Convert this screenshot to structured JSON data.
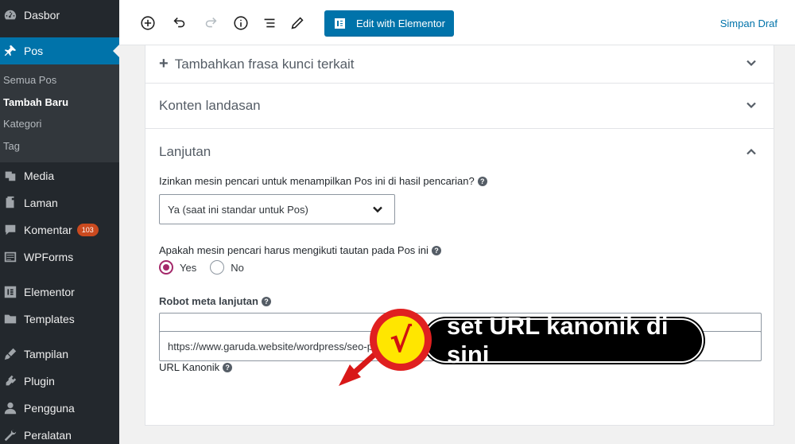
{
  "sidebar": {
    "items_top": [
      {
        "label": "Dasbor",
        "icon": "dashboard-icon"
      },
      {
        "label": "Pos",
        "icon": "pin-icon",
        "active": true
      }
    ],
    "submenu": [
      "Semua Pos",
      "Tambah Baru",
      "Kategori",
      "Tag"
    ],
    "items_bottom": [
      {
        "label": "Media",
        "icon": "media-icon"
      },
      {
        "label": "Laman",
        "icon": "pages-icon"
      },
      {
        "label": "Komentar",
        "icon": "comments-icon",
        "badge": "103"
      },
      {
        "label": "WPForms",
        "icon": "wpforms-icon"
      },
      {
        "label": "Elementor",
        "icon": "elementor-icon"
      },
      {
        "label": "Templates",
        "icon": "folder-icon"
      },
      {
        "label": "Tampilan",
        "icon": "appearance-icon"
      },
      {
        "label": "Plugin",
        "icon": "plugin-icon"
      },
      {
        "label": "Pengguna",
        "icon": "user-icon"
      },
      {
        "label": "Peralatan",
        "icon": "tools-icon"
      }
    ]
  },
  "toolbar": {
    "elementor_label": "Edit with Elementor",
    "save_draft": "Simpan Draf"
  },
  "panel": {
    "related_keyphrase": "Tambahkan frasa kunci terkait",
    "cornerstone": "Konten landasan",
    "advanced": "Lanjutan",
    "q_search": "Izinkan mesin pencari untuk menampilkan Pos ini di hasil pencarian?",
    "search_select_value": "Ya (saat ini standar untuk Pos)",
    "q_follow": "Apakah mesin pencari harus mengikuti tautan pada Pos ini",
    "radio_yes": "Yes",
    "radio_no": "No",
    "robots_label": "Robot meta lanjutan",
    "robots_value": "",
    "canonical_label": "URL Kanonik",
    "canonical_value": "https://www.garuda.website/wordpress/seo-plugin/"
  },
  "annotation": {
    "check": "√",
    "text": "set URL kanonik di sini"
  },
  "colors": {
    "sidebar_bg": "#23282d",
    "accent": "#0073aa",
    "radio_checked": "#a4286a",
    "badge": "#ca4a1f"
  }
}
